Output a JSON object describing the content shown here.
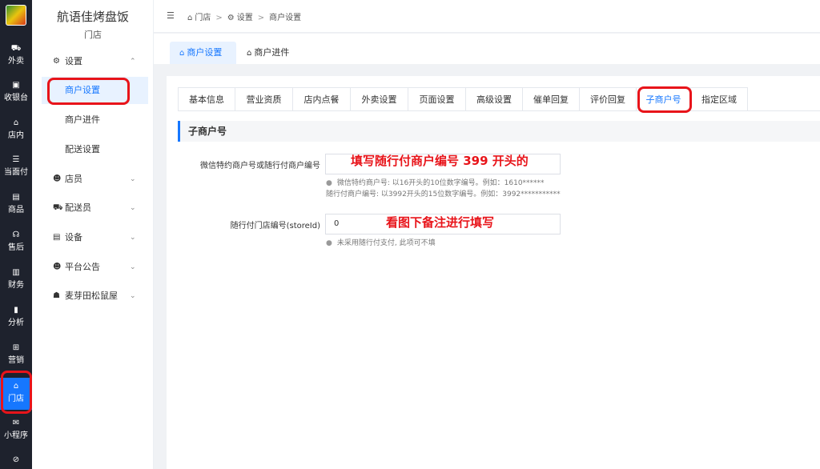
{
  "rail": {
    "items": [
      {
        "label": "外卖",
        "icon": "takeout-icon",
        "glyph": "⛟"
      },
      {
        "label": "收银台",
        "icon": "cashier-icon",
        "glyph": "▣"
      },
      {
        "label": "店内",
        "icon": "dine-in-icon",
        "glyph": "⌂"
      },
      {
        "label": "当面付",
        "icon": "face-pay-icon",
        "glyph": "☰"
      },
      {
        "label": "商品",
        "icon": "goods-icon",
        "glyph": "▤"
      },
      {
        "label": "售后",
        "icon": "after-sales-icon",
        "glyph": "☊"
      },
      {
        "label": "财务",
        "icon": "finance-icon",
        "glyph": "▥"
      },
      {
        "label": "分析",
        "icon": "analytics-icon",
        "glyph": "▮"
      },
      {
        "label": "营销",
        "icon": "marketing-icon",
        "glyph": "⊞"
      },
      {
        "label": "门店",
        "icon": "store-icon",
        "glyph": "⌂"
      },
      {
        "label": "小程序",
        "icon": "mini-program-icon",
        "glyph": "✉"
      }
    ]
  },
  "menu": {
    "store_name": "航语佳烤盘饭",
    "store_type": "门店",
    "groups": [
      {
        "label": "设置",
        "icon": "gear-icon",
        "glyph": "⚙",
        "chevron": "⌃"
      },
      {
        "label": "店员",
        "icon": "staff-icon",
        "glyph": "☻",
        "chevron": "⌄"
      },
      {
        "label": "配送员",
        "icon": "courier-icon",
        "glyph": "⛟",
        "chevron": "⌄"
      },
      {
        "label": "设备",
        "icon": "printer-icon",
        "glyph": "▤",
        "chevron": "⌄"
      },
      {
        "label": "平台公告",
        "icon": "announcement-icon",
        "glyph": "☻",
        "chevron": "⌄"
      },
      {
        "label": "麦芽田松鼠屋",
        "icon": "team-icon",
        "glyph": "☗",
        "chevron": "⌄"
      }
    ],
    "subitems": [
      "商户设置",
      "商户进件",
      "配送设置"
    ]
  },
  "breadcrumb": {
    "items": [
      "门店",
      "设置",
      "商户设置"
    ],
    "sep": ">"
  },
  "page_tabs": [
    "商户设置",
    "商户进件"
  ],
  "sub_tabs": [
    "基本信息",
    "营业资质",
    "店内点餐",
    "外卖设置",
    "页面设置",
    "高级设置",
    "催单回复",
    "评价回复",
    "子商户号",
    "指定区域"
  ],
  "section_title": "子商户号",
  "form": {
    "merchant_label": "微信特约商户号或随行付商户编号",
    "merchant_value": "",
    "merchant_annotation": "填写随行付商户编号 399 开头的",
    "merchant_hint_1": "微信特约商户号: 以16开头的10位数字编号。例如：1610******",
    "merchant_hint_2": "随行付商户编号: 以3992开头的15位数字编号。例如：3992***********",
    "store_label": "随行付门店编号(storeId)",
    "store_value": "0",
    "store_annotation": "看图下备注进行填写",
    "store_hint": "未采用随行付支付, 此项可不填"
  },
  "colors": {
    "accent": "#1677ff",
    "annotation": "#e8141a",
    "rail_bg": "#1e222d"
  }
}
